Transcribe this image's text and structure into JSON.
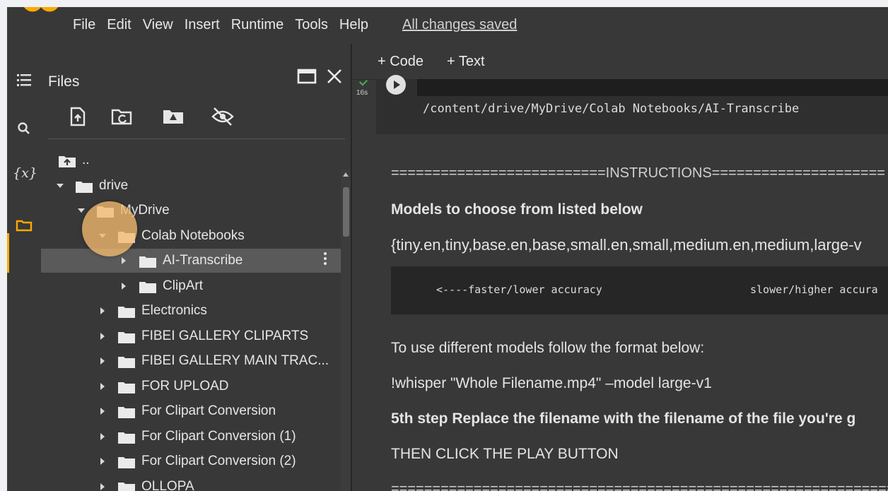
{
  "menubar": {
    "items": [
      "File",
      "Edit",
      "View",
      "Insert",
      "Runtime",
      "Tools",
      "Help"
    ],
    "status": "All changes saved"
  },
  "files_panel": {
    "title": "Files",
    "tree": [
      {
        "label": "..",
        "indent": 0,
        "arrow": "none",
        "icon": "parent"
      },
      {
        "label": "drive",
        "indent": 0,
        "arrow": "down"
      },
      {
        "label": "MyDrive",
        "indent": 1,
        "arrow": "down"
      },
      {
        "label": "Colab Notebooks",
        "indent": 2,
        "arrow": "down"
      },
      {
        "label": "AI-Transcribe",
        "indent": 3,
        "arrow": "right",
        "selected": true
      },
      {
        "label": "ClipArt",
        "indent": 3,
        "arrow": "right"
      },
      {
        "label": "Electronics",
        "indent": 2,
        "arrow": "right"
      },
      {
        "label": "FIBEI GALLERY CLIPARTS",
        "indent": 2,
        "arrow": "right"
      },
      {
        "label": "FIBEI GALLERY MAIN TRAC...",
        "indent": 2,
        "arrow": "right"
      },
      {
        "label": "FOR UPLOAD",
        "indent": 2,
        "arrow": "right"
      },
      {
        "label": "For Clipart Conversion",
        "indent": 2,
        "arrow": "right"
      },
      {
        "label": "For Clipart Conversion (1)",
        "indent": 2,
        "arrow": "right"
      },
      {
        "label": "For Clipart Conversion (2)",
        "indent": 2,
        "arrow": "right"
      },
      {
        "label": "OLLOPA",
        "indent": 2,
        "arrow": "right"
      }
    ]
  },
  "notebook": {
    "add_code": "+ Code",
    "add_text": "+ Text",
    "cell_runtime": "16s",
    "cell_output": "/content/drive/MyDrive/Colab Notebooks/AI-Transcribe",
    "instructions_header": "==========================INSTRUCTIONS=====================",
    "models_heading": "Models to choose from listed below",
    "models_list": "{tiny.en,tiny,base.en,base,small.en,small,medium.en,medium,large-v",
    "code_left": "<----faster/lower accuracy",
    "code_right": "slower/higher accura",
    "format_text": "To use different models follow the format below:",
    "example_cmd": "!whisper \"Whole Filename.mp4\" –model large-v1",
    "step5": "5th step Replace the filename with the filename of the file you're g",
    "play_text": "THEN CLICK THE PLAY BUTTON",
    "footer_rule": "=============================================================="
  },
  "colors": {
    "background": "#383838",
    "accent": "#f9ab00",
    "selected_row": "#5a5a5a"
  }
}
